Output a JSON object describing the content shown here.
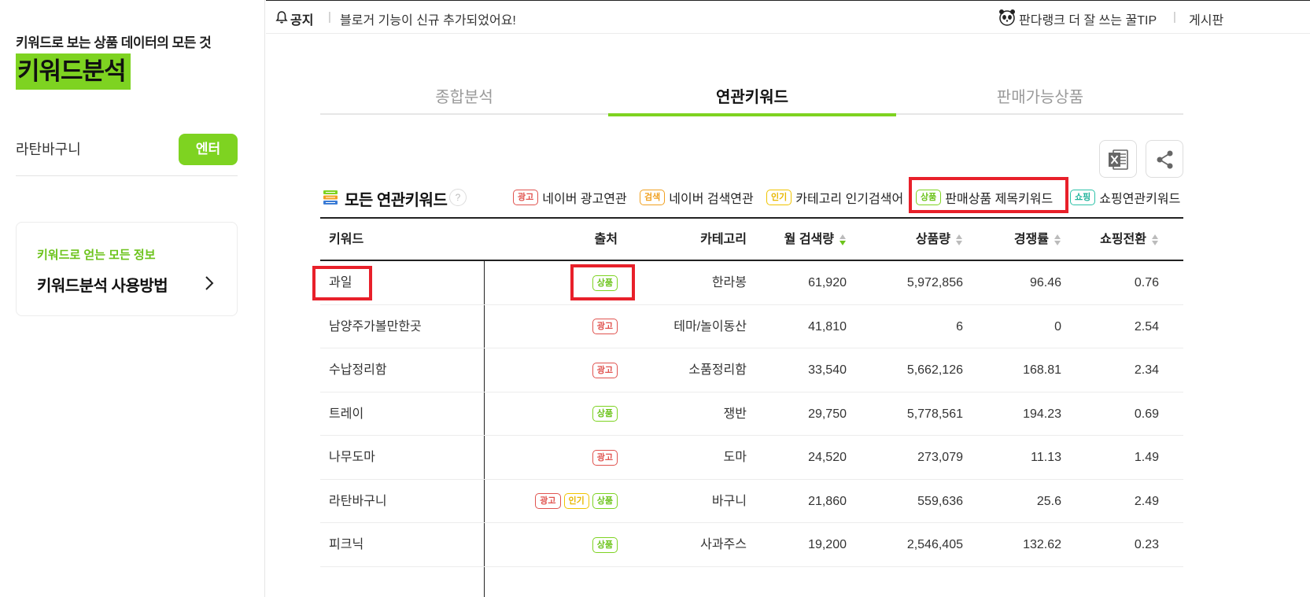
{
  "sidebar": {
    "tagline": "키워드로 보는 상품 데이터의 모든 것",
    "brand": "키워드분석",
    "search_value": "라탄바구니",
    "enter_label": "엔터",
    "guide_sub": "키워드로 얻는 모든 정보",
    "guide_title": "키워드분석 사용방법"
  },
  "topbar": {
    "notice_label": "공지",
    "notice_text": "블로거 기능이 신규 추가되었어요!",
    "tip_link": "판다랭크 더 잘 쓰는 꿀TIP",
    "board_link": "게시판"
  },
  "tabs": [
    {
      "label": "종합분석",
      "active": false
    },
    {
      "label": "연관키워드",
      "active": true
    },
    {
      "label": "판매가능상품",
      "active": false
    }
  ],
  "section": {
    "title": "모든 연관키워드",
    "help": "?"
  },
  "badges": {
    "ad": "광고",
    "search": "검색",
    "pop": "인기",
    "prod": "상품",
    "shop": "쇼핑"
  },
  "legend": [
    {
      "type": "ad",
      "label": "네이버 광고연관"
    },
    {
      "type": "search",
      "label": "네이버 검색연관"
    },
    {
      "type": "pop",
      "label": "카테고리 인기검색어"
    },
    {
      "type": "prod",
      "label": "판매상품 제목키워드"
    },
    {
      "type": "shop",
      "label": "쇼핑연관키워드"
    }
  ],
  "table": {
    "headers": {
      "keyword": "키워드",
      "source": "출처",
      "category": "카테고리",
      "volume": "월 검색량",
      "count": "상품량",
      "competition": "경쟁률",
      "conversion": "쇼핑전환"
    },
    "rows": [
      {
        "keyword": "과일",
        "sources": [
          "prod"
        ],
        "category": "한라봉",
        "volume": "61,920",
        "count": "5,972,856",
        "competition": "96.46",
        "conversion": "0.76"
      },
      {
        "keyword": "남양주가볼만한곳",
        "sources": [
          "ad"
        ],
        "category": "테마/놀이동산",
        "volume": "41,810",
        "count": "6",
        "competition": "0",
        "conversion": "2.54"
      },
      {
        "keyword": "수납정리함",
        "sources": [
          "ad"
        ],
        "category": "소품정리함",
        "volume": "33,540",
        "count": "5,662,126",
        "competition": "168.81",
        "conversion": "2.34"
      },
      {
        "keyword": "트레이",
        "sources": [
          "prod"
        ],
        "category": "쟁반",
        "volume": "29,750",
        "count": "5,778,561",
        "competition": "194.23",
        "conversion": "0.69"
      },
      {
        "keyword": "나무도마",
        "sources": [
          "ad"
        ],
        "category": "도마",
        "volume": "24,520",
        "count": "273,079",
        "competition": "11.13",
        "conversion": "1.49"
      },
      {
        "keyword": "라탄바구니",
        "sources": [
          "ad",
          "pop",
          "prod"
        ],
        "category": "바구니",
        "volume": "21,860",
        "count": "559,636",
        "competition": "25.6",
        "conversion": "2.49"
      },
      {
        "keyword": "피크닉",
        "sources": [
          "prod"
        ],
        "category": "사과주스",
        "volume": "19,200",
        "count": "2,546,405",
        "competition": "132.62",
        "conversion": "0.23"
      }
    ]
  },
  "colors": {
    "accent": "#7ed321",
    "highlight": "#e8202a"
  }
}
